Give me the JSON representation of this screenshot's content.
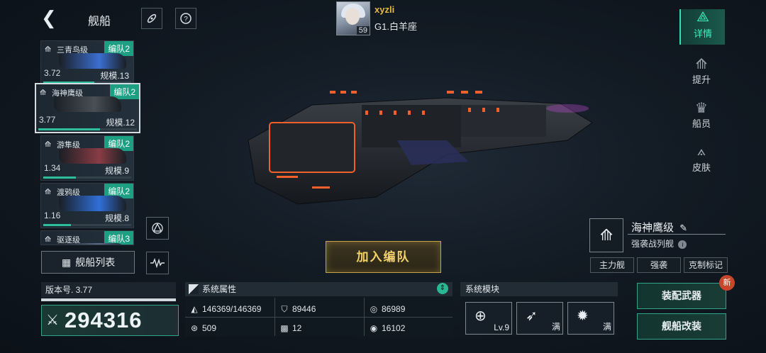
{
  "header": {
    "back_icon": "back-arrow-icon",
    "title": "舰船",
    "rocket_icon": "rocket-icon",
    "help_icon": "question-mark-icon"
  },
  "player": {
    "name": "xyzli",
    "level": "59",
    "rank": "G1.白羊座"
  },
  "ship_list": [
    {
      "name": "三青鸟级",
      "fleet": "编队2",
      "value": "3.72",
      "scale": "规模.13",
      "progress": 0.55,
      "hull_color": "#3b6fd1",
      "selected": false
    },
    {
      "name": "海神鹰级",
      "fleet": "编队2",
      "value": "3.77",
      "scale": "规模.12",
      "progress": 0.6,
      "hull_color": "#4a4f56",
      "selected": true
    },
    {
      "name": "游隼级",
      "fleet": "编队2",
      "value": "1.34",
      "scale": "规模.9",
      "progress": 0.35,
      "hull_color": "#8a3c45",
      "selected": false
    },
    {
      "name": "渡鸦级",
      "fleet": "编队2",
      "value": "1.16",
      "scale": "规模.8",
      "progress": 0.3,
      "hull_color": "#2f6fd8",
      "selected": false
    },
    {
      "name": "驱逐级",
      "fleet": "编队3",
      "value": "",
      "scale": "",
      "progress": 0,
      "hull_color": "#5a6c8a",
      "selected": false
    }
  ],
  "ship_list_button": "舰船列表",
  "right_nav": [
    {
      "label": "详情",
      "icon": "ship-detail-icon",
      "active": true
    },
    {
      "label": "提升",
      "icon": "upgrade-icon",
      "active": false
    },
    {
      "label": "船员",
      "icon": "crew-icon",
      "active": false
    },
    {
      "label": "皮肤",
      "icon": "skin-icon",
      "active": false
    }
  ],
  "join_fleet_button": "加入编队",
  "ship_info": {
    "name": "海神鹰级",
    "type": "强袭战列舰",
    "tags": [
      "主力舰",
      "强袭",
      "克制标记"
    ]
  },
  "version": "版本号. 3.77",
  "power": "294316",
  "attributes": {
    "title": "系统属性",
    "items": [
      {
        "icon": "armor-icon",
        "value": "146369/146369"
      },
      {
        "icon": "shield-icon",
        "value": "89446"
      },
      {
        "icon": "target-icon",
        "value": "86989"
      },
      {
        "icon": "speed-icon",
        "value": "509"
      },
      {
        "icon": "checker-icon",
        "value": "12"
      },
      {
        "icon": "eye-icon",
        "value": "16102"
      }
    ]
  },
  "modules": {
    "title": "系统模块",
    "slots": [
      {
        "icon": "radar-module-icon",
        "status": "Lv.9"
      },
      {
        "icon": "missile-module-icon",
        "status": "满"
      },
      {
        "icon": "burst-module-icon",
        "status": "满"
      }
    ]
  },
  "actions": {
    "equip_weapons": "装配武器",
    "modify_ship": "舰船改装",
    "new_badge": "新"
  },
  "colors": {
    "accent": "#2de0b3",
    "fleet_tag": "#1d9f83",
    "gold": "#f3d36a",
    "player_name": "#e6b947"
  }
}
